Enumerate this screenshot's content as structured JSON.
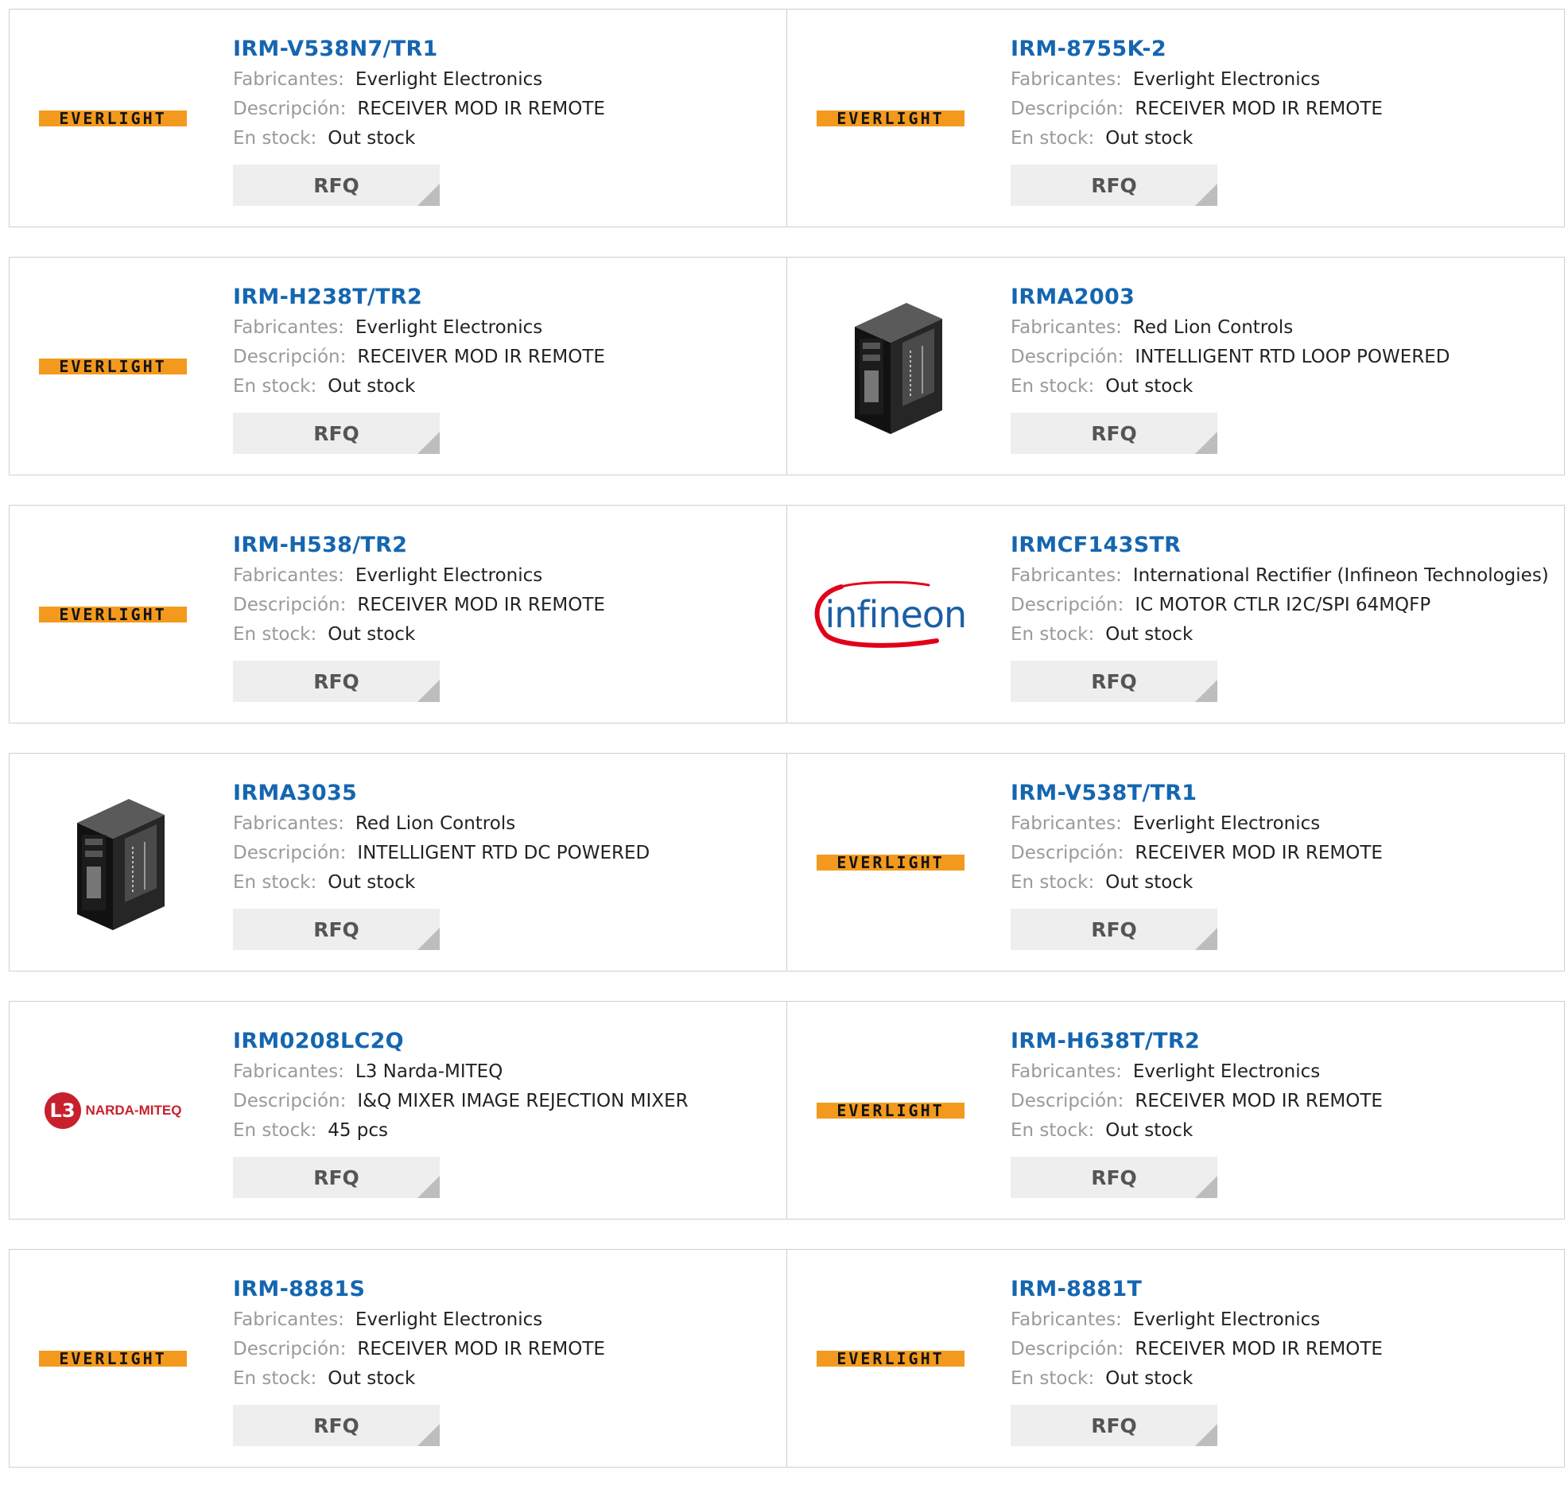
{
  "labels": {
    "manufacturer": "Fabricantes:",
    "description": "Descripción:",
    "stock": "En stock:",
    "rfq": "RFQ"
  },
  "logos": {
    "everlight": "EVERLIGHT",
    "infineon": "infineon",
    "narda_badge": "L3",
    "narda_name": "NARDA-MITEQ"
  },
  "colors": {
    "title": "#1566b0",
    "everlight_orange": "#f39a1e",
    "infineon_red": "#e2001a",
    "infineon_blue": "#1b5ea6",
    "narda_red": "#c8202c"
  },
  "rows": [
    [
      {
        "part": "IRM-V538N7/TR1",
        "manufacturer": "Everlight Electronics",
        "description": "RECEIVER MOD IR REMOTE",
        "stock": "Out stock",
        "logo": "everlight"
      },
      {
        "part": "IRM-8755K-2",
        "manufacturer": "Everlight Electronics",
        "description": "RECEIVER MOD IR REMOTE",
        "stock": "Out stock",
        "logo": "everlight"
      }
    ],
    [
      {
        "part": "IRM-H238T/TR2",
        "manufacturer": "Everlight Electronics",
        "description": "RECEIVER MOD IR REMOTE",
        "stock": "Out stock",
        "logo": "everlight"
      },
      {
        "part": "IRMA2003",
        "manufacturer": "Red Lion Controls",
        "description": "INTELLIGENT RTD LOOP POWERED",
        "stock": "Out stock",
        "logo": "module"
      }
    ],
    [
      {
        "part": "IRM-H538/TR2",
        "manufacturer": "Everlight Electronics",
        "description": "RECEIVER MOD IR REMOTE",
        "stock": "Out stock",
        "logo": "everlight"
      },
      {
        "part": "IRMCF143STR",
        "manufacturer": "International Rectifier (Infineon Technologies)",
        "description": "IC MOTOR CTLR I2C/SPI 64MQFP",
        "stock": "Out stock",
        "logo": "infineon"
      }
    ],
    [
      {
        "part": "IRMA3035",
        "manufacturer": "Red Lion Controls",
        "description": "INTELLIGENT RTD DC POWERED",
        "stock": "Out stock",
        "logo": "module"
      },
      {
        "part": "IRM-V538T/TR1",
        "manufacturer": "Everlight Electronics",
        "description": "RECEIVER MOD IR REMOTE",
        "stock": "Out stock",
        "logo": "everlight"
      }
    ],
    [
      {
        "part": "IRM0208LC2Q",
        "manufacturer": "L3 Narda-MITEQ",
        "description": "I&Q MIXER IMAGE REJECTION MIXER",
        "stock": "45 pcs",
        "logo": "narda"
      },
      {
        "part": "IRM-H638T/TR2",
        "manufacturer": "Everlight Electronics",
        "description": "RECEIVER MOD IR REMOTE",
        "stock": "Out stock",
        "logo": "everlight"
      }
    ],
    [
      {
        "part": "IRM-8881S",
        "manufacturer": "Everlight Electronics",
        "description": "RECEIVER MOD IR REMOTE",
        "stock": "Out stock",
        "logo": "everlight"
      },
      {
        "part": "IRM-8881T",
        "manufacturer": "Everlight Electronics",
        "description": "RECEIVER MOD IR REMOTE",
        "stock": "Out stock",
        "logo": "everlight"
      }
    ]
  ]
}
